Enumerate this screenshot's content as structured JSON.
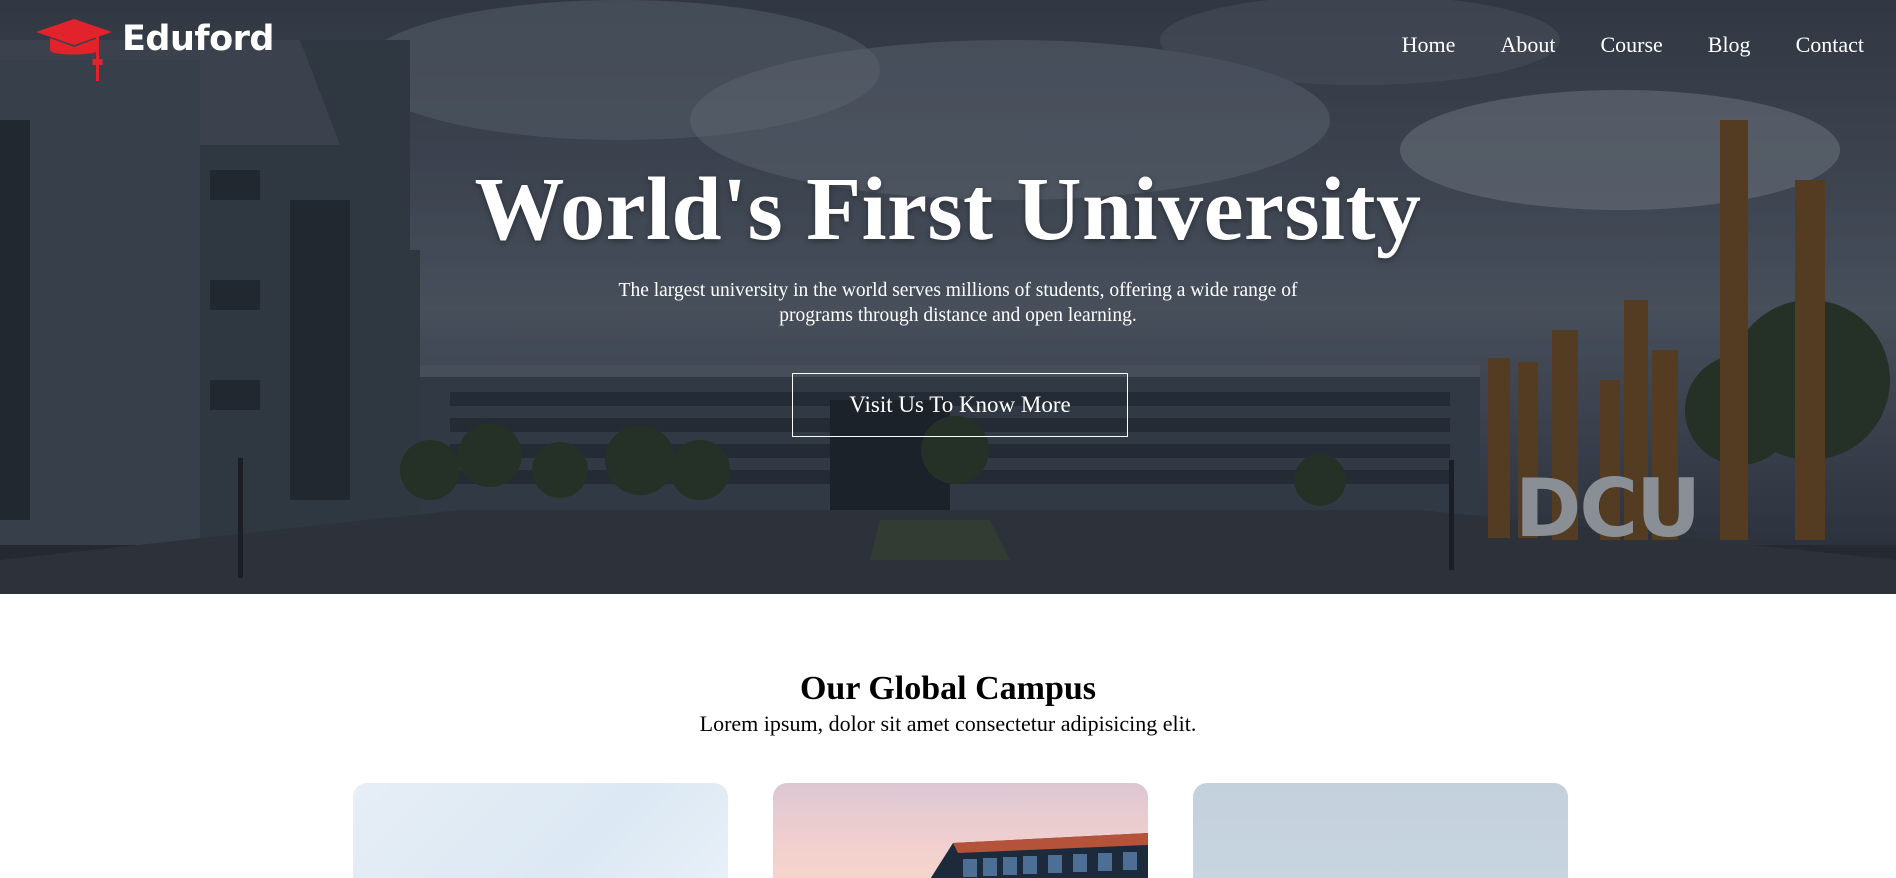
{
  "brand": {
    "name": "Eduford",
    "accent_color": "#e3232c",
    "icon": "graduation-cap-icon"
  },
  "nav": {
    "items": [
      {
        "label": "Home"
      },
      {
        "label": "About"
      },
      {
        "label": "Course"
      },
      {
        "label": "Blog"
      },
      {
        "label": "Contact"
      }
    ]
  },
  "hero": {
    "title": "World's First University",
    "subtitle": "The largest university in the world serves millions of students, offering a wide range of programs through distance and open learning.",
    "button_label": "Visit Us To Know More",
    "sign_text": "DCU"
  },
  "campus": {
    "title": "Our Global Campus",
    "subtitle": "Lorem ipsum, dolor sit amet consectetur adipisicing elit."
  }
}
